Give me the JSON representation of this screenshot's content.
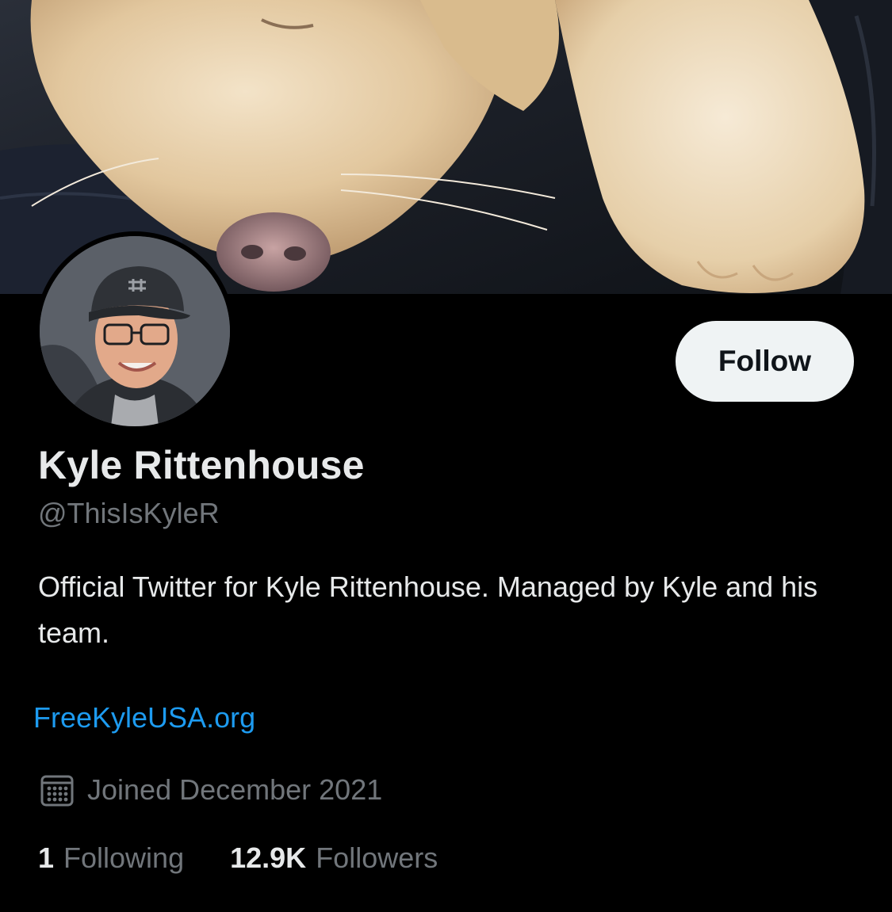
{
  "profile": {
    "display_name": "Kyle Rittenhouse",
    "handle": "@ThisIsKyleR",
    "bio": "Official Twitter for Kyle Rittenhouse. Managed by Kyle and his team.",
    "website": "FreeKyleUSA.org",
    "joined": "Joined December 2021",
    "follow_label": "Follow"
  },
  "stats": {
    "following_count": "1",
    "following_label": "Following",
    "followers_count": "12.9K",
    "followers_label": "Followers"
  },
  "icons": {
    "calendar": "calendar-icon"
  },
  "colors": {
    "background": "#000000",
    "primary_text": "#e7e9ea",
    "secondary_text": "#71767b",
    "link": "#1d9bf0",
    "follow_button_bg": "#eff3f4"
  }
}
